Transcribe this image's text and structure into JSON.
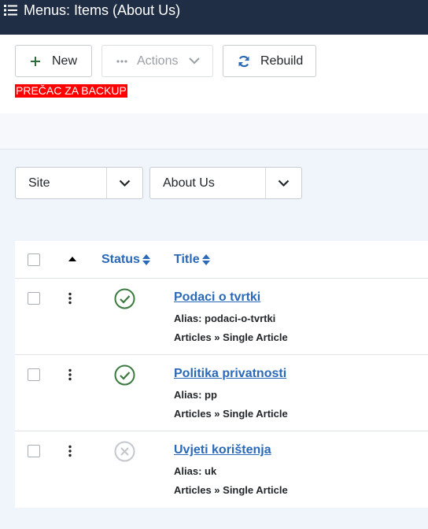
{
  "header": {
    "title": "Menus: Items (About Us)"
  },
  "toolbar": {
    "new_label": "New",
    "actions_label": "Actions",
    "rebuild_label": "Rebuild",
    "backup_label": "PREČAC ZA BACKUP"
  },
  "filters": {
    "site": "Site",
    "menu": "About Us"
  },
  "table": {
    "headers": {
      "status": "Status",
      "title": "Title"
    },
    "rows": [
      {
        "title": "Podaci o tvrtki",
        "alias": "Alias: podaci-o-tvrtki",
        "type": "Articles » Single Article",
        "status": "published"
      },
      {
        "title": "Politika privatnosti",
        "alias": "Alias: pp",
        "type": "Articles » Single Article",
        "status": "published"
      },
      {
        "title": "Uvjeti korištenja",
        "alias": "Alias: uk",
        "type": "Articles » Single Article",
        "status": "unpublished"
      }
    ]
  },
  "colors": {
    "header_bg": "#1f2e45",
    "link": "#2a69b8",
    "published": "#3b7a3f",
    "unpublished": "#c4c8cc",
    "backup_bg": "#ff0000"
  }
}
